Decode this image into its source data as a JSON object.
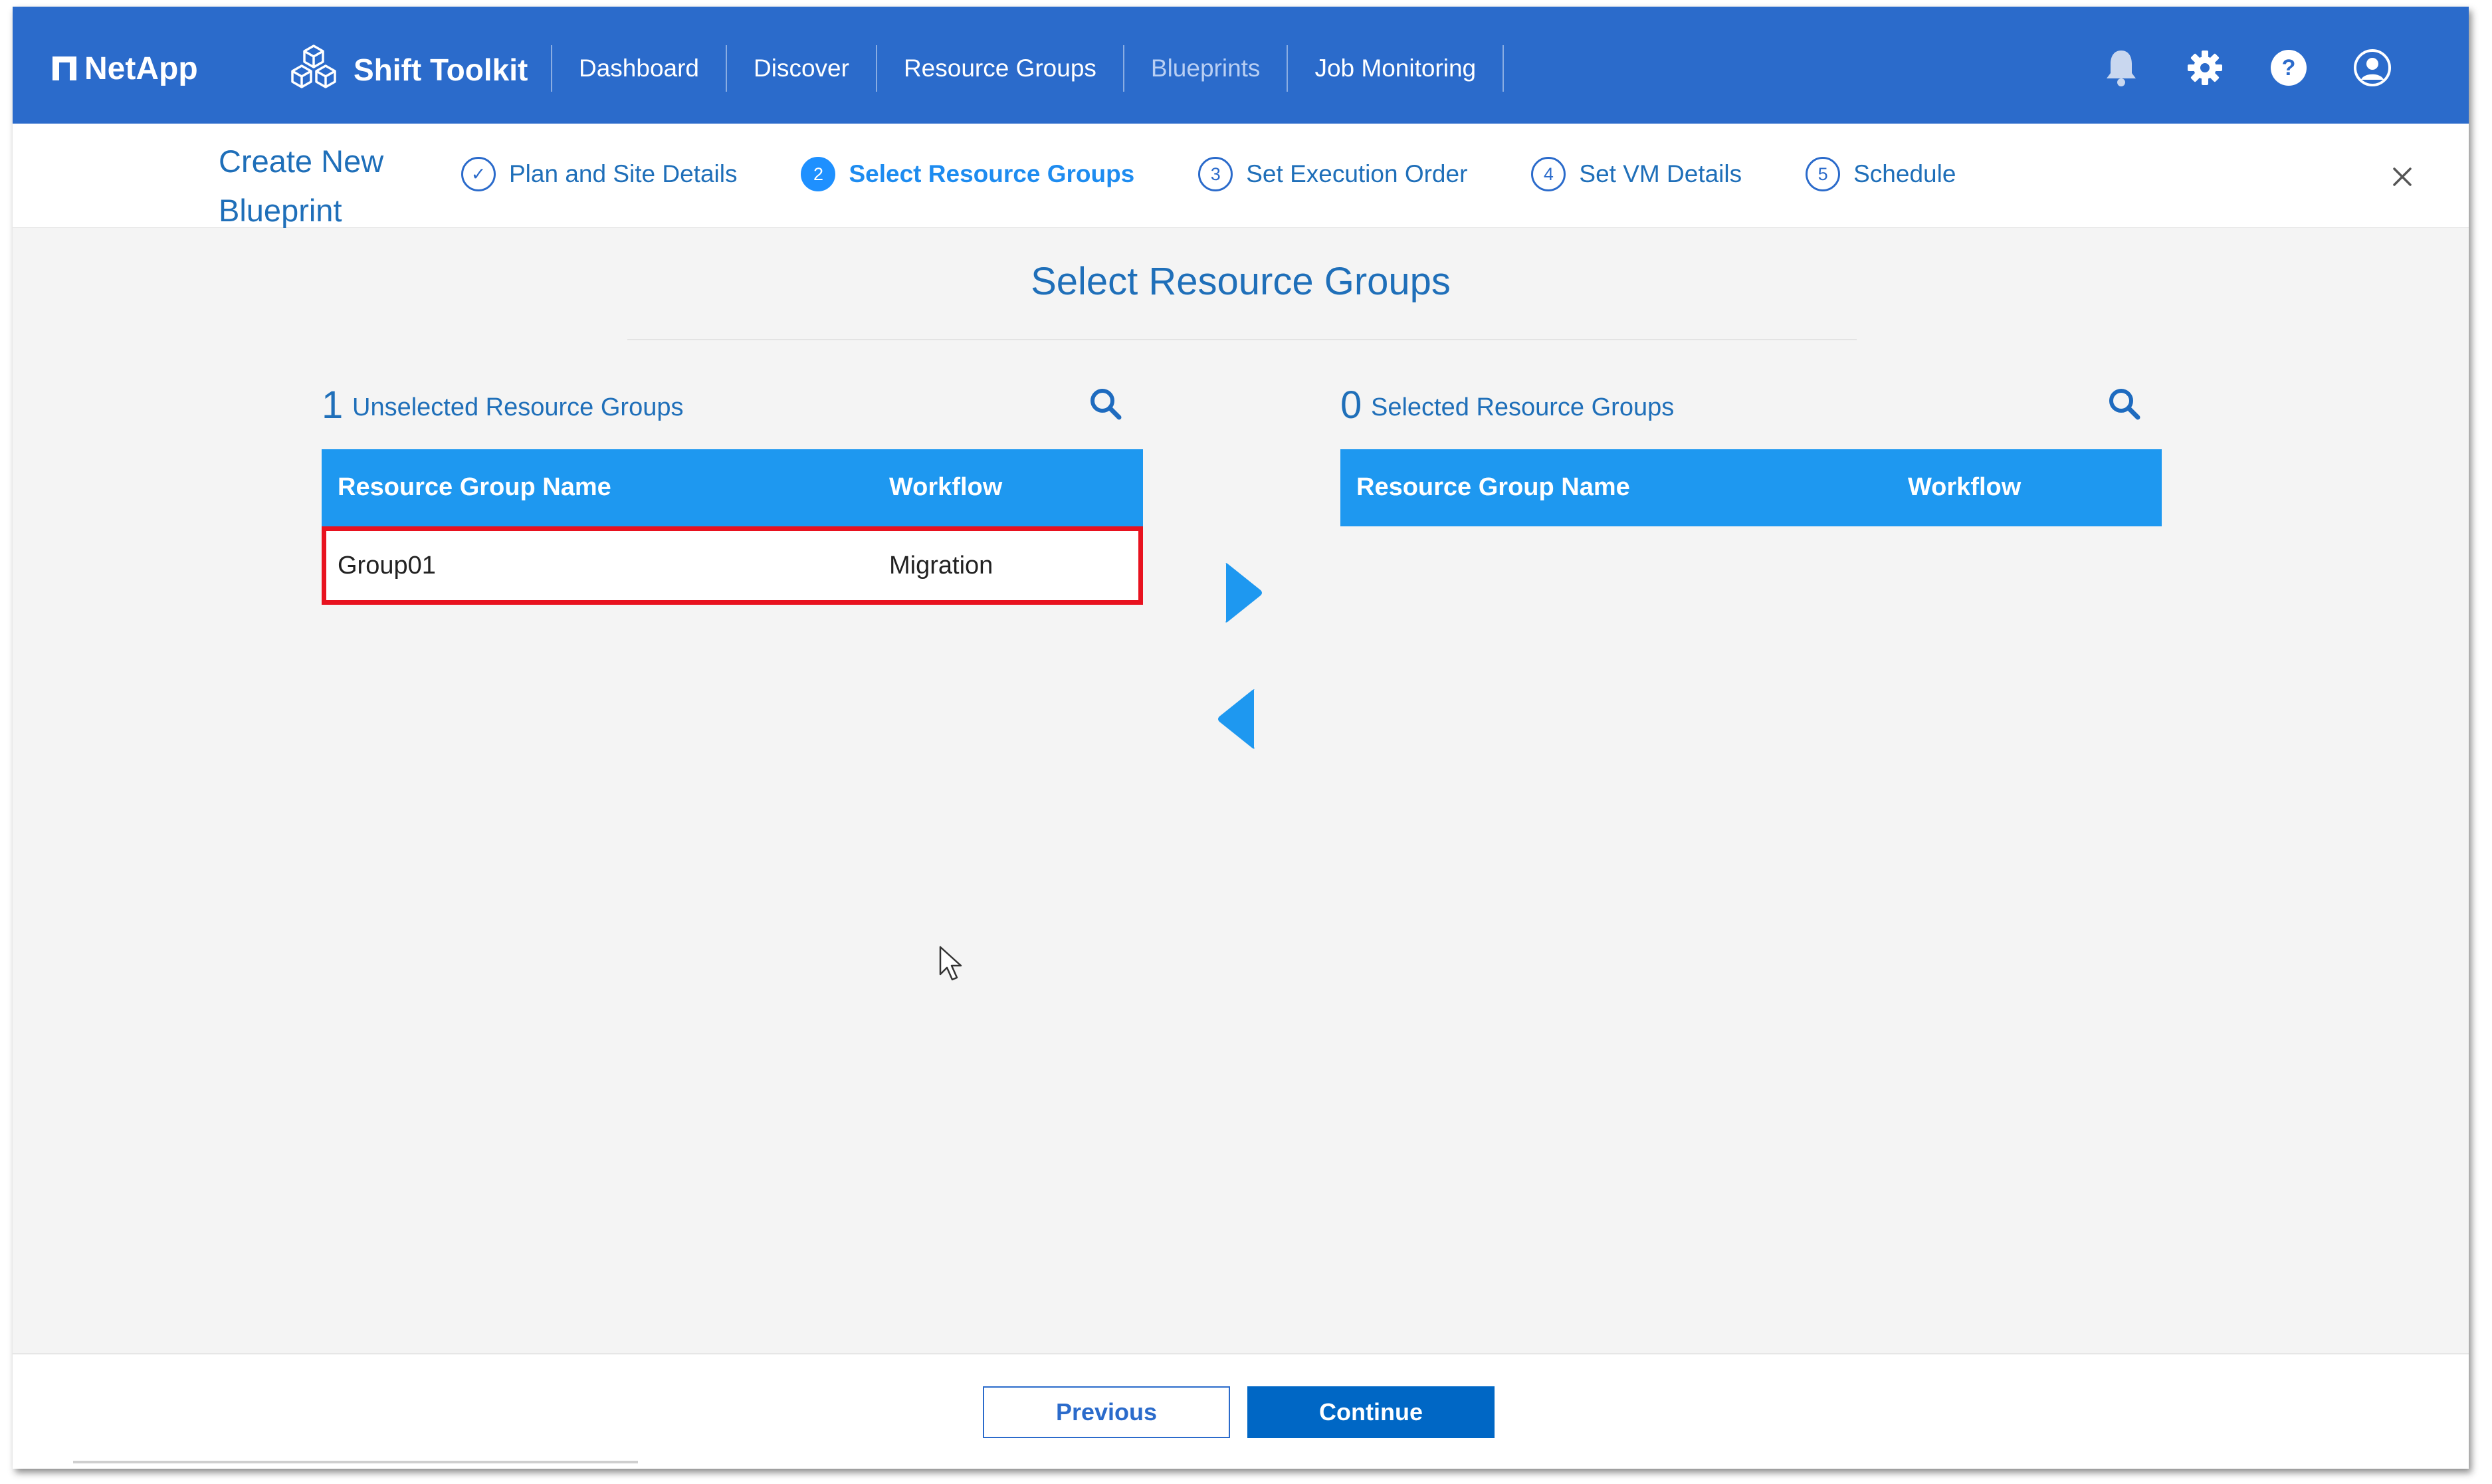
{
  "brand": {
    "name": "NetApp"
  },
  "product": {
    "name": "Shift Toolkit"
  },
  "nav": {
    "items": [
      {
        "label": "Dashboard"
      },
      {
        "label": "Discover"
      },
      {
        "label": "Resource Groups"
      },
      {
        "label": "Blueprints",
        "active": true
      },
      {
        "label": "Job Monitoring"
      }
    ]
  },
  "top_icons": [
    "bell-icon",
    "gear-icon",
    "help-icon",
    "user-icon"
  ],
  "wizard": {
    "title": "Create New Blueprint",
    "steps": [
      {
        "marker": "✓",
        "label": "Plan and Site Details",
        "state": "done"
      },
      {
        "marker": "2",
        "label": "Select Resource Groups",
        "state": "active"
      },
      {
        "marker": "3",
        "label": "Set Execution Order",
        "state": "pending"
      },
      {
        "marker": "4",
        "label": "Set VM Details",
        "state": "pending"
      },
      {
        "marker": "5",
        "label": "Schedule",
        "state": "pending"
      }
    ]
  },
  "page": {
    "title": "Select Resource Groups"
  },
  "unselected": {
    "count": "1",
    "label": "Unselected Resource Groups",
    "columns": [
      "Resource Group Name",
      "Workflow"
    ],
    "rows": [
      {
        "name": "Group01",
        "workflow": "Migration"
      }
    ]
  },
  "selected": {
    "count": "0",
    "label": "Selected Resource Groups",
    "columns": [
      "Resource Group Name",
      "Workflow"
    ],
    "rows": []
  },
  "footer": {
    "previous_label": "Previous",
    "continue_label": "Continue"
  },
  "colors": {
    "nav_bg": "#2b6bcb",
    "table_header": "#1e98f0",
    "highlight": "#e8121f",
    "accent_text": "#1f6fb9"
  }
}
